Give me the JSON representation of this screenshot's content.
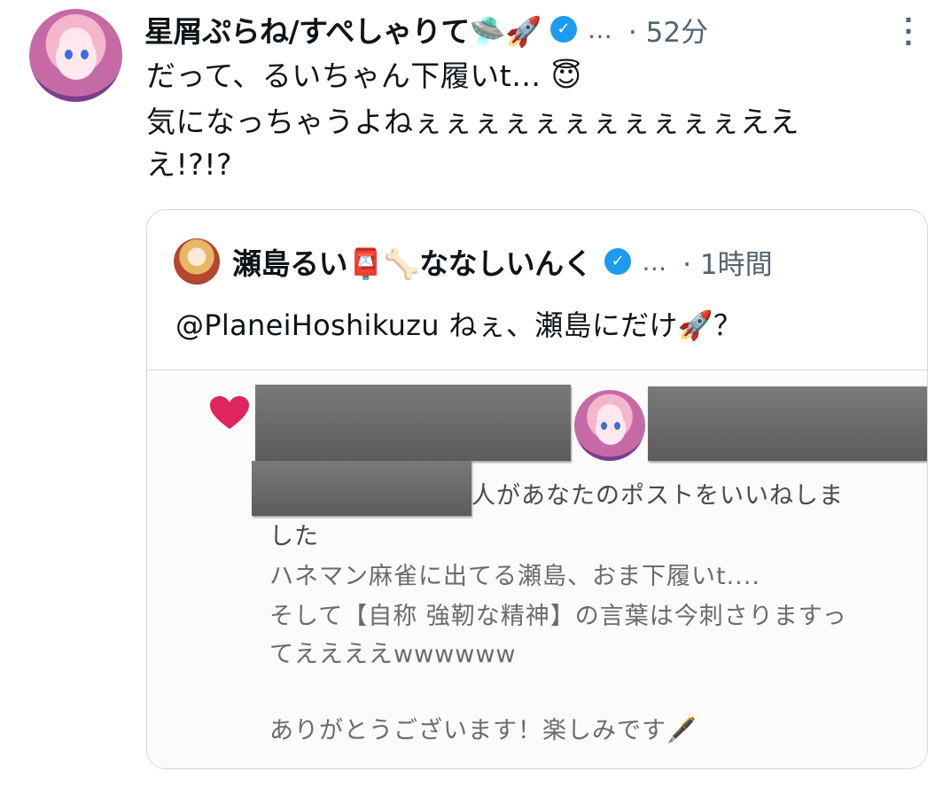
{
  "tweet": {
    "author_name": "星屑ぷらね/すぺしゃりて🛸🚀",
    "more_text": "…",
    "time": "· 52分",
    "more_icon": "vertical-ellipsis-icon",
    "lines": [
      "だって、るいちゃん下履いt… 😇",
      "気になっちゃうよねぇぇぇぇぇぇぇぇぇぇぇええ",
      "え!?!?"
    ]
  },
  "quote": {
    "author_name": "瀬島るい📮🦴ななしいんく",
    "more_text": "…",
    "time": "· 1時間",
    "text": "@PlaneiHoshikuzu ねぇ、瀬島にだけ🚀？"
  },
  "notification": {
    "heart_icon": "heart-icon",
    "line1_suffix": "人があなたのポストをいいねしま",
    "line2": "した",
    "body_lines": [
      "ハネマン麻雀に出てる瀬島、おま下履いt....",
      "そして【自称 強靭な精神】の言葉は今刺さりますっ",
      "てええええwwwwww",
      "",
      "ありがとうございます！楽しみです🖋️"
    ]
  },
  "colors": {
    "verified": "#1d9bf0",
    "heart": "#e0245e",
    "muted": "#536471",
    "border": "#cfd9de"
  }
}
